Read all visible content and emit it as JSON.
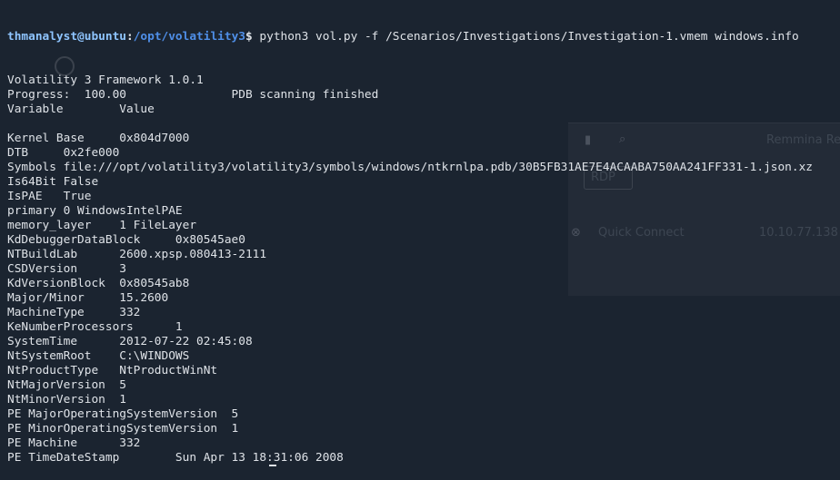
{
  "prompt": {
    "user_host": "thmanalyst@ubuntu",
    "separator": ":",
    "cwd": "/opt/volatility3",
    "symbol": "$",
    "command": " python3 vol.py -f /Scenarios/Investigations/Investigation-1.vmem windows.info"
  },
  "output": [
    "Volatility 3 Framework 1.0.1",
    "Progress:  100.00\t\tPDB scanning finished",
    "Variable\tValue",
    "",
    "Kernel Base\t0x804d7000",
    "DTB\t0x2fe000",
    "Symbols\tfile:///opt/volatility3/volatility3/symbols/windows/ntkrnlpa.pdb/30B5FB31AE7E4ACAABA750AA241FF331-1.json.xz",
    "Is64Bit\tFalse",
    "IsPAE\tTrue",
    "primary\t0 WindowsIntelPAE",
    "memory_layer\t1 FileLayer",
    "KdDebuggerDataBlock\t0x80545ae0",
    "NTBuildLab\t2600.xpsp.080413-2111",
    "CSDVersion\t3",
    "KdVersionBlock\t0x80545ab8",
    "Major/Minor\t15.2600",
    "MachineType\t332",
    "KeNumberProcessors\t1",
    "SystemTime\t2012-07-22 02:45:08",
    "NtSystemRoot\tC:\\WINDOWS",
    "NtProductType\tNtProductWinNt",
    "NtMajorVersion\t5",
    "NtMinorVersion\t1",
    "PE MajorOperatingSystemVersion\t5",
    "PE MinorOperatingSystemVersion\t1",
    "PE Machine\t332",
    "PE TimeDateStamp\tSun Apr 13 18:31:06 2008"
  ],
  "background": {
    "ghost_label_top": "Remmina Re",
    "ghost_dropdown": "RDP",
    "ghost_connect": "Quick Connect",
    "ghost_ip": "10.10.77.138"
  },
  "colors": {
    "background": "#1b2430",
    "text": "#dfe3e8",
    "user_host": "#8fc5ff",
    "path": "#4f8fe8"
  },
  "icons": [
    "search-icon",
    "file-icon",
    "close-circle-icon"
  ]
}
